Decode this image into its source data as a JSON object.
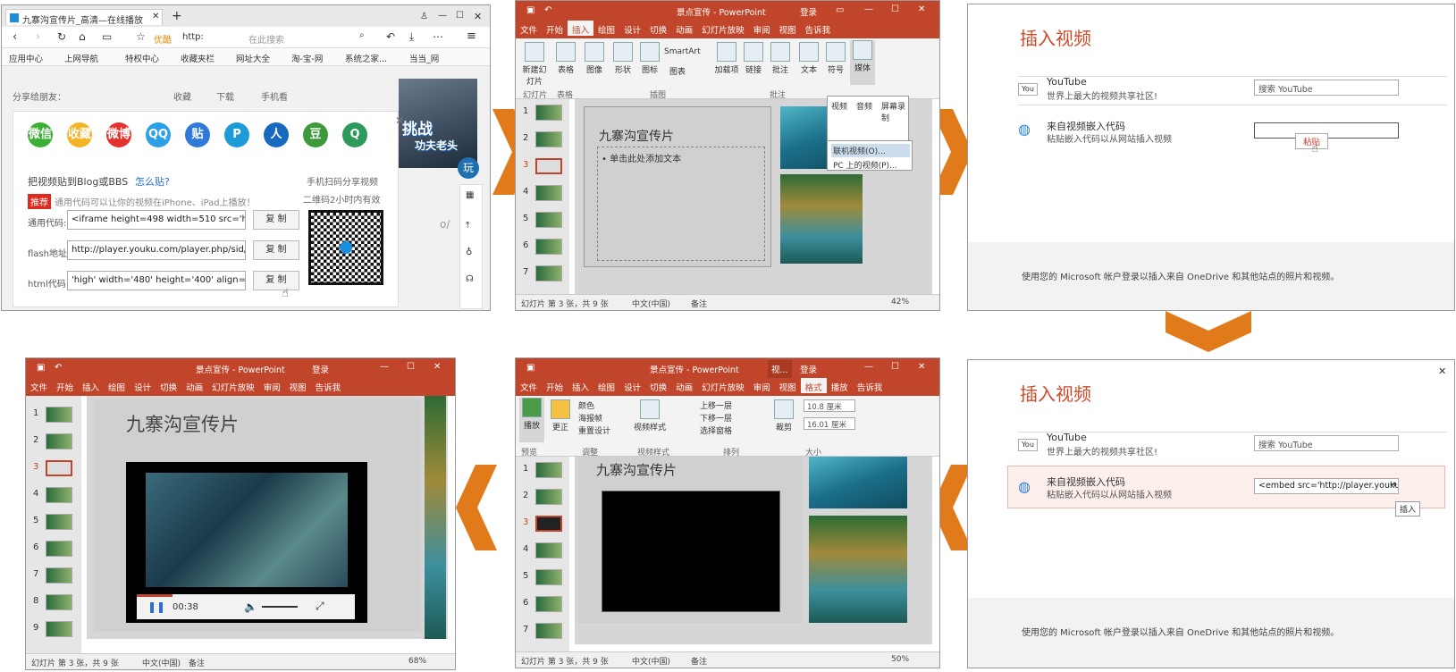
{
  "browser": {
    "tab_title": "九寨沟宣传片_高清—在线播放",
    "addr_label": "优酷",
    "addr_text": "http:",
    "search_placeholder": "在此搜索",
    "bookmarks": [
      "应用中心",
      "上网导航",
      "特权中心",
      "收藏夹栏",
      "网址大全",
      "淘-宝-网",
      "系统之家...",
      "当当_网"
    ],
    "share_label": "分享给朋友：",
    "toolbar": [
      "收藏",
      "下载",
      "手机看"
    ],
    "share_icons": [
      "微信",
      "收藏",
      "微博",
      "QQ",
      "贴",
      "P",
      "人",
      "豆",
      "Q"
    ],
    "blog_title": "把视频贴到Blog或BBS",
    "blog_link": "怎么贴?",
    "recommend_badge": "推荐",
    "recommend_text": "通用代码可以让你的视频在iPhone、iPad上播放！",
    "qr_title1": "手机扫码分享视频",
    "qr_title2": "二维码2小时内有效",
    "rows": [
      {
        "label": "通用代码:",
        "value": "<iframe height=498 width=510 src='http:",
        "button": "复 制"
      },
      {
        "label": "flash地址:",
        "value": "http://player.youku.com/player.php/sid/XO",
        "button": "复 制"
      },
      {
        "label": "html代码:",
        "value": "'high' width='480' height='400' align='middle",
        "button": "复 制"
      }
    ],
    "ad_text1": "挑战",
    "ad_text2": "功夫老头",
    "ad_text3": "玩",
    "side_text": "o/"
  },
  "ppt1": {
    "title": "景点宣传 - PowerPoint",
    "login": "登录",
    "menu": [
      "文件",
      "开始",
      "插入",
      "绘图",
      "设计",
      "切换",
      "动画",
      "幻灯片放映",
      "审阅",
      "视图",
      "告诉我"
    ],
    "ribbon": [
      "新建幻灯片",
      "表格",
      "图像",
      "形状",
      "图标",
      "SmartArt",
      "图表",
      "加载项",
      "链接",
      "批注",
      "文本",
      "符号",
      "媒体"
    ],
    "groups": [
      "幻灯片",
      "表格",
      "插图",
      "批注"
    ],
    "media_menu": [
      "视频",
      "音频",
      "屏幕录制"
    ],
    "dropdown": [
      "联机视频(O)...",
      "PC 上的视频(P)..."
    ],
    "slide_title": "九寨沟宣传片",
    "slide_bullet": "• 单击此处添加文本",
    "thumbs": [
      "1",
      "2",
      "3",
      "4",
      "5",
      "6",
      "7"
    ],
    "status_left": "幻灯片 第 3 张，共 9 张",
    "status_lang": "中文(中国)",
    "status_notes": "备注",
    "zoom": "42%"
  },
  "dialog1": {
    "title": "插入视频",
    "yt_logo": "You",
    "yt_title": "YouTube",
    "yt_sub": "世界上最大的视频共享社区!",
    "yt_search": "搜索  YouTube",
    "embed_title": "来自视频嵌入代码",
    "embed_sub": "粘贴嵌入代码以从网站插入视频",
    "paste_label": "粘贴",
    "footer": "使用您的 Microsoft 帐户登录以插入来自 OneDrive 和其他站点的照片和视频。"
  },
  "dialog2": {
    "title": "插入视频",
    "yt_logo": "You",
    "yt_title": "YouTube",
    "yt_sub": "世界上最大的视频共享社区!",
    "yt_search": "搜索  YouTube",
    "embed_title": "来自视频嵌入代码",
    "embed_sub": "粘贴嵌入代码以从网站插入视频",
    "embed_value": "<embed src='http://player.youku.c",
    "insert_tip": "插入",
    "footer": "使用您的 Microsoft 帐户登录以插入来自 OneDrive 和其他站点的照片和视频。"
  },
  "ppt2": {
    "title": "景点宣传 - PowerPoint",
    "context_tab": "视...",
    "login": "登录",
    "menu": [
      "文件",
      "开始",
      "插入",
      "绘图",
      "设计",
      "切换",
      "动画",
      "幻灯片放映",
      "审阅",
      "视图",
      "格式",
      "播放",
      "告诉我"
    ],
    "ribbon": [
      "播放",
      "更正",
      "颜色",
      "海报帧",
      "重置设计",
      "视频样式",
      "上移一层",
      "下移一层",
      "选择窗格",
      "裁剪"
    ],
    "height_val": "10.8 厘米",
    "width_val": "16.01 厘米",
    "groups": [
      "预览",
      "调整",
      "视频样式",
      "排列",
      "大小"
    ],
    "slide_title": "九寨沟宣传片",
    "thumbs": [
      "1",
      "2",
      "3",
      "4",
      "5",
      "6",
      "7"
    ],
    "status_left": "幻灯片 第 3 张，共 9 张",
    "status_lang": "中文(中国)",
    "status_notes": "备注",
    "zoom": "50%"
  },
  "ppt3": {
    "title": "景点宣传 - PowerPoint",
    "login": "登录",
    "menu": [
      "文件",
      "开始",
      "插入",
      "绘图",
      "设计",
      "切换",
      "动画",
      "幻灯片放映",
      "审阅",
      "视图",
      "告诉我"
    ],
    "slide_title": "九寨沟宣传片",
    "thumbs": [
      "1",
      "2",
      "3",
      "4",
      "5",
      "6",
      "7",
      "8",
      "9"
    ],
    "time": "00:38",
    "status_left": "幻灯片 第 3 张，共 9 张",
    "status_lang": "中文(中国)",
    "status_notes": "备注",
    "zoom": "68%"
  },
  "colors": {
    "accent": "#c0452a",
    "arrow": "#e07a1a",
    "dialog_title": "#d04a2a"
  }
}
